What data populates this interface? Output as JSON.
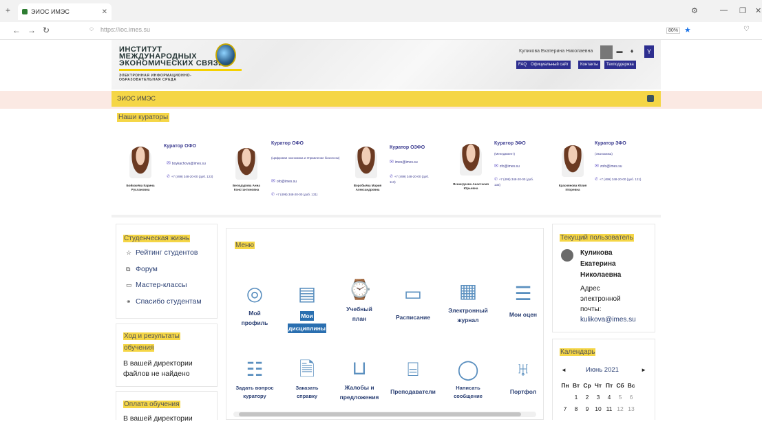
{
  "browser": {
    "tab_title": "ЭИОС ИМЭС",
    "url": "https://ioc.imes.su",
    "zoom": "80%"
  },
  "header": {
    "logo_line1": "ИНСТИТУТ",
    "logo_line2": "МЕЖДУНАРОДНЫХ",
    "logo_line3": "ЭКОНОМИЧЕСКИХ СВЯЗЕЙ",
    "logo_sub1": "ЭЛЕКТРОННАЯ ИНФОРМАЦИОННО-",
    "logo_sub2": "ОБРАЗОВАТЕЛЬНАЯ СРЕДА",
    "username": "Куликова Екатерина Николаевна",
    "buttons": [
      "FAQ",
      "Официальный сайт",
      "Контакты",
      "Техподдержка"
    ]
  },
  "nav": {
    "label": "ЭИОС ИМЭС"
  },
  "curators": {
    "title": "Наши кураторы",
    "items": [
      {
        "role": "Куратор ОФО",
        "sub": "",
        "email": "boykachova@imes.su",
        "phone": "+7 (499) 348-20-00 (доб. 123)",
        "name": "Бойкачёва Карина Руслановна"
      },
      {
        "role": "Куратор ОФО",
        "sub": "(Цифровая экономика и Управление бизнесом)",
        "email": "ofo@imes.su",
        "phone": "+7 (499) 348-20-00 (доб. 131)",
        "name": "Белодурова Анна Константиновна"
      },
      {
        "role": "Куратор ОЗФО",
        "sub": "",
        "email": "imes@imes.su",
        "phone": "+7 (499) 348-20-00 (доб. 113)",
        "name": "Воробьёва Мария Александровна"
      },
      {
        "role": "Куратор ЗФО",
        "sub": "(Менеджмент)",
        "email": "zfo@imes.su",
        "phone": "+7 (499) 348-20-00 (доб. 133)",
        "name": "Яснюгдеева Анастасия Юрьевна"
      },
      {
        "role": "Куратор ЗФО",
        "sub": "(Экономика)",
        "email": "zofo@imes.su",
        "phone": "+7 (499) 348-20-00 (доб. 121)",
        "name": "Краснянова Юлия Игоревна"
      }
    ]
  },
  "student_life": {
    "title": "Студенческая жизнь",
    "items": [
      {
        "icon": "star-icon",
        "label": "Рейтинг студентов"
      },
      {
        "icon": "forum-icon",
        "label": "Форум"
      },
      {
        "icon": "screen-icon",
        "label": "Мастер-классы"
      },
      {
        "icon": "handshake-icon",
        "label": "Спасибо студентам"
      }
    ]
  },
  "progress": {
    "title_line1": "Ход и результаты",
    "title_line2": "обучения",
    "text_line1": "В вашей директории",
    "text_line2": "файлов не найдено"
  },
  "payment": {
    "title": "Оплата обучения",
    "text_line1": "В вашей директории"
  },
  "menu": {
    "title": "Меню",
    "row1": [
      {
        "icon": "profile-icon",
        "l1": "Мой",
        "l2": "профиль"
      },
      {
        "icon": "disciplines-icon",
        "l1": "Мои",
        "l2": "дисциплины",
        "selected": true
      },
      {
        "icon": "plan-icon",
        "l1": "Учебный",
        "l2": "план"
      },
      {
        "icon": "schedule-icon",
        "l1": "Расписание",
        "l2": ""
      },
      {
        "icon": "journal-icon",
        "l1": "Электронный",
        "l2": "журнал"
      },
      {
        "icon": "grades-icon",
        "l1": "Мои оцен",
        "l2": ""
      }
    ],
    "row2": [
      {
        "icon": "question-icon",
        "l1": "Задать вопрос",
        "l2": "куратору"
      },
      {
        "icon": "certificate-icon",
        "l1": "Заказать",
        "l2": "справку"
      },
      {
        "icon": "book-icon",
        "l1": "Жалобы и",
        "l2": "предложения"
      },
      {
        "icon": "teacher-icon",
        "l1": "Преподаватели",
        "l2": ""
      },
      {
        "icon": "message-icon",
        "l1": "Написать",
        "l2": "сообщение"
      },
      {
        "icon": "trophy-icon",
        "l1": "Портфол",
        "l2": ""
      }
    ]
  },
  "current_user": {
    "title": "Текущий пользователь",
    "name_line1": "Куликова",
    "name_line2": "Екатерина",
    "name_line3": "Николаевна",
    "email_label1": "Адрес",
    "email_label2": "электронной",
    "email_label3": "почты:",
    "email": "kulikova@imes.su"
  },
  "calendar": {
    "title": "Календарь",
    "month": "Июнь 2021",
    "weekdays": [
      "Пн",
      "Вт",
      "Ср",
      "Чт",
      "Пт",
      "Сб",
      "Вс"
    ],
    "week1": [
      "",
      "1",
      "2",
      "3",
      "4",
      "5",
      "6"
    ],
    "week2": [
      "7",
      "8",
      "9",
      "10",
      "11",
      "12",
      "13"
    ]
  }
}
